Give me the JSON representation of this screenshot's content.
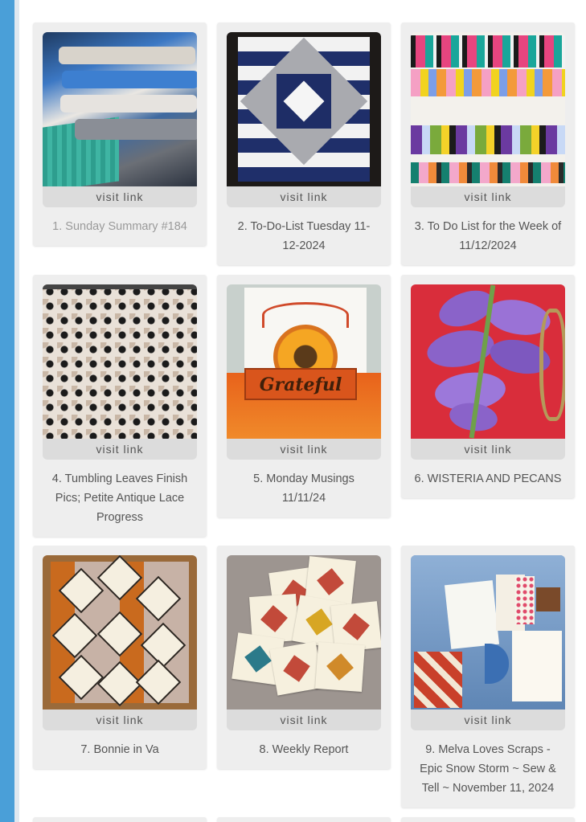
{
  "cards": [
    {
      "title": "1. Sunday Summary #184",
      "link": "visit link",
      "visited": true
    },
    {
      "title": "2. To-Do-List Tuesday 11-12-2024",
      "link": "visit link"
    },
    {
      "title": "3. To Do List for the Week of 11/12/2024",
      "link": "visit link"
    },
    {
      "title": "4. Tumbling Leaves Finish Pics; Petite Antique Lace Progress",
      "link": "visit link"
    },
    {
      "title": "5. Monday Musings 11/11/24",
      "link": "visit link"
    },
    {
      "title": "6. WISTERIA AND PECANS",
      "link": "visit link"
    },
    {
      "title": "7. Bonnie in Va",
      "link": "visit link"
    },
    {
      "title": "8. Weekly Report",
      "link": "visit link"
    },
    {
      "title": "9. Melva Loves Scraps - Epic Snow Storm ~ Sew & Tell ~ November 11, 2024",
      "link": "visit link"
    }
  ],
  "thumbnails": {
    "card5_word": "Grateful"
  },
  "colors": {
    "sidebar": "#4a9fd8",
    "card_bg": "#eeeeee",
    "visit_bg": "#dcdcdc",
    "text": "#555555",
    "visited_text": "#9a9a9a"
  }
}
